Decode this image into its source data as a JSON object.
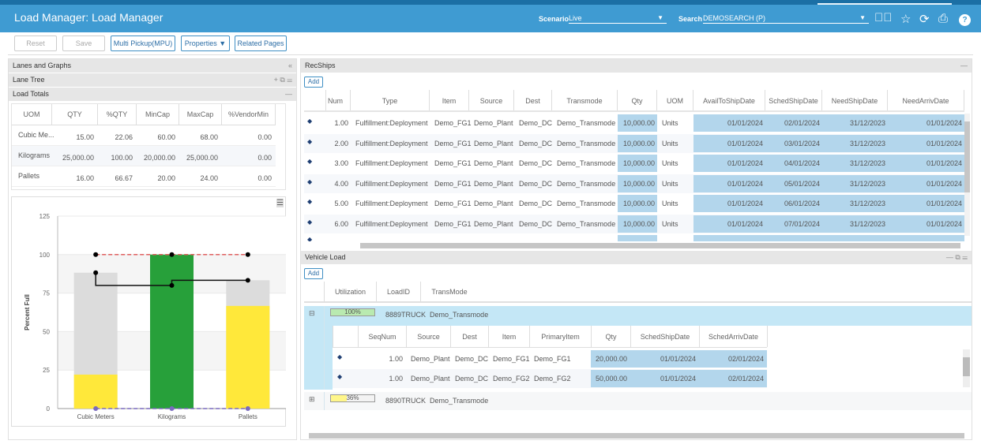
{
  "header": {
    "title": "Load Manager: Load Manager",
    "scenario_label": "Scenario",
    "scenario_value": "Live",
    "search_label": "Search",
    "search_value": "DEMOSEARCH (P)",
    "icons": [
      "go-arrow-icon",
      "star-icon",
      "refresh-icon",
      "print-icon",
      "help-icon"
    ]
  },
  "toolbar": {
    "reset": "Reset",
    "save": "Save",
    "multi_pickup": "Multi Pickup(MPU)",
    "properties": "Properties ▼",
    "related_pages": "Related Pages"
  },
  "left": {
    "lanes_and_graphs": "Lanes and Graphs",
    "lane_tree": "Lane Tree",
    "load_totals": "Load Totals",
    "totals_columns": [
      "UOM",
      "QTY",
      "%QTY",
      "MinCap",
      "MaxCap",
      "%VendorMin"
    ],
    "totals_rows": [
      [
        "Cubic Me...",
        "15.00",
        "22.06",
        "60.00",
        "68.00",
        "0.00"
      ],
      [
        "Kilograms",
        "25,000.00",
        "100.00",
        "20,000.00",
        "25,000.00",
        "0.00"
      ],
      [
        "Pallets",
        "16.00",
        "66.67",
        "20.00",
        "24.00",
        "0.00"
      ]
    ]
  },
  "chart_data": {
    "type": "bar",
    "categories": [
      "Cubic Meters",
      "Kilograms",
      "Pallets"
    ],
    "ylabel": "Percent Full",
    "ylim": [
      0,
      125
    ],
    "yticks": [
      0,
      25,
      50,
      75,
      100,
      125
    ],
    "grid": true,
    "series": [
      {
        "kind": "bar",
        "values": [
          22.06,
          100,
          66.67
        ],
        "colors": [
          "#ffe83a",
          "#27a03a",
          "#ffe83a"
        ]
      },
      {
        "kind": "bar-background",
        "values": [
          88.24,
          80,
          83.33
        ],
        "color": "#dcdcdc"
      },
      {
        "kind": "step-line",
        "values": [
          88.24,
          80,
          83.33
        ],
        "color": "#111111"
      },
      {
        "kind": "dashed-line",
        "values": [
          100,
          100,
          100
        ],
        "color": "#e06060"
      },
      {
        "kind": "dashed-line",
        "values": [
          0,
          0,
          0
        ],
        "color": "#7a6abf"
      }
    ]
  },
  "recships": {
    "title": "RecShips",
    "add": "Add",
    "columns": [
      "Num",
      "Type",
      "Item",
      "Source",
      "Dest",
      "Transmode",
      "Qty",
      "UOM",
      "AvailToShipDate",
      "SchedShipDate",
      "NeedShipDate",
      "NeedArrivDate"
    ],
    "rows": [
      [
        "1.00",
        "Fulfillment:Deployment",
        "Demo_FG1",
        "Demo_Plant",
        "Demo_DC",
        "Demo_Transmode",
        "10,000.00",
        "Units",
        "01/01/2024",
        "02/01/2024",
        "31/12/2023",
        "01/01/2024"
      ],
      [
        "2.00",
        "Fulfillment:Deployment",
        "Demo_FG1",
        "Demo_Plant",
        "Demo_DC",
        "Demo_Transmode",
        "10,000.00",
        "Units",
        "01/01/2024",
        "03/01/2024",
        "31/12/2023",
        "01/01/2024"
      ],
      [
        "3.00",
        "Fulfillment:Deployment",
        "Demo_FG1",
        "Demo_Plant",
        "Demo_DC",
        "Demo_Transmode",
        "10,000.00",
        "Units",
        "01/01/2024",
        "04/01/2024",
        "31/12/2023",
        "01/01/2024"
      ],
      [
        "4.00",
        "Fulfillment:Deployment",
        "Demo_FG1",
        "Demo_Plant",
        "Demo_DC",
        "Demo_Transmode",
        "10,000.00",
        "Units",
        "01/01/2024",
        "05/01/2024",
        "31/12/2023",
        "01/01/2024"
      ],
      [
        "5.00",
        "Fulfillment:Deployment",
        "Demo_FG1",
        "Demo_Plant",
        "Demo_DC",
        "Demo_Transmode",
        "10,000.00",
        "Units",
        "01/01/2024",
        "06/01/2024",
        "31/12/2023",
        "01/01/2024"
      ],
      [
        "6.00",
        "Fulfillment:Deployment",
        "Demo_FG1",
        "Demo_Plant",
        "Demo_DC",
        "Demo_Transmode",
        "10,000.00",
        "Units",
        "01/01/2024",
        "07/01/2024",
        "31/12/2023",
        "01/01/2024"
      ]
    ]
  },
  "vehicle": {
    "title": "Vehicle Load",
    "add": "Add",
    "columns": [
      "Utilization",
      "LoadID",
      "TransMode"
    ],
    "loads": [
      {
        "util": "100%",
        "util_pct": 100,
        "util_color": "#b9eab0",
        "load_id": "8889TRUCK",
        "transmode": "Demo_Transmode"
      },
      {
        "util": "36%",
        "util_pct": 36,
        "util_color": "#fff68a",
        "load_id": "8890TRUCK",
        "transmode": "Demo_Transmode"
      }
    ],
    "detail_columns": [
      "SeqNum",
      "Source",
      "Dest",
      "Item",
      "PrimaryItem",
      "Qty",
      "SchedShipDate",
      "SchedArrivDate"
    ],
    "detail_rows": [
      [
        "1.00",
        "Demo_Plant",
        "Demo_DC",
        "Demo_FG1",
        "Demo_FG1",
        "20,000.00",
        "01/01/2024",
        "02/01/2024"
      ],
      [
        "1.00",
        "Demo_Plant",
        "Demo_DC",
        "Demo_FG2",
        "Demo_FG2",
        "50,000.00",
        "01/01/2024",
        "02/01/2024"
      ]
    ]
  }
}
